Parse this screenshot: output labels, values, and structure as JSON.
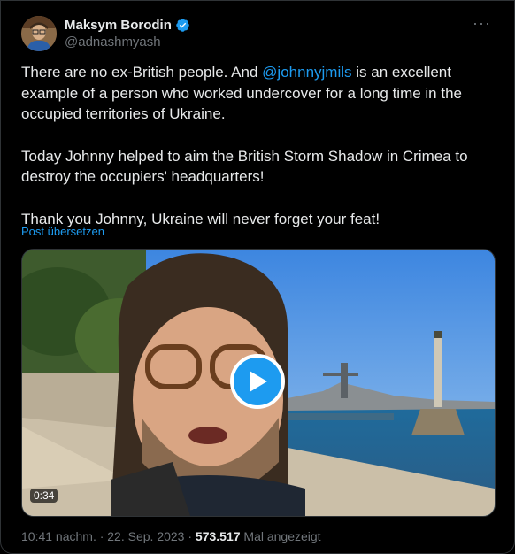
{
  "author": {
    "name": "Maksym Borodin",
    "handle": "@adnashmyash"
  },
  "tweet": {
    "line1_before": "There are no ex-British people. And ",
    "mention": "@johnnyjmils",
    "line1_after": " is an excellent example of a person who worked undercover for a long time in the occupied territories of Ukraine.",
    "paragraph2": "Today Johnny helped to aim the British Storm Shadow in Crimea to destroy the occupiers' headquarters!",
    "paragraph3": "Thank you Johnny, Ukraine will never forget your feat!"
  },
  "translate_label": "Post übersetzen",
  "video": {
    "duration": "0:34"
  },
  "meta": {
    "timestamp": "10:41 nachm. · 22. Sep. 2023 · ",
    "views_count": "573.517",
    "views_label": " Mal angezeigt"
  },
  "colors": {
    "accent": "#1d9bf0",
    "background": "#000000",
    "secondary_text": "#71767b"
  }
}
